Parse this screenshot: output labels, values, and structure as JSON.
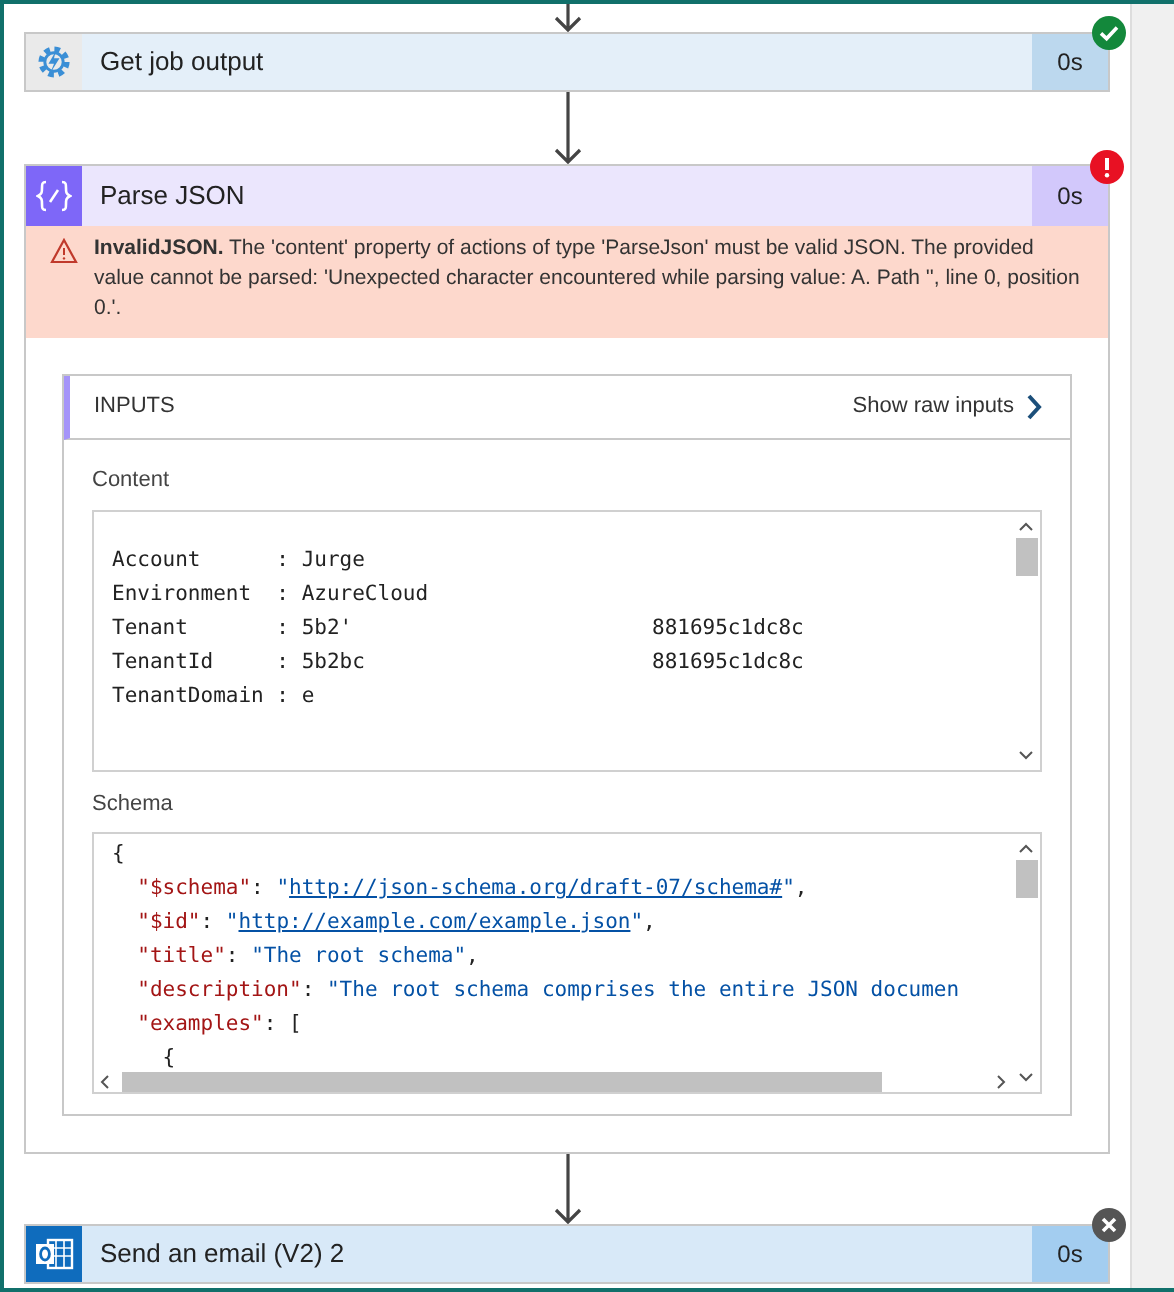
{
  "steps": [
    {
      "kind": "automation",
      "title": "Get job output",
      "duration": "0s",
      "succeeded": true,
      "failed": false,
      "skipped": false,
      "expanded": false
    },
    {
      "kind": "parse",
      "title": "Parse JSON",
      "duration": "0s",
      "succeeded": false,
      "failed": true,
      "skipped": false,
      "expanded": true,
      "error": "**InvalidJSON.** The 'content' property of actions of type 'ParseJson' must be valid JSON. The provided value cannot be parsed: 'Unexpected character encountered while parsing value: A. Path '', line 0, position 0.'.",
      "inputs": {
        "heading": "INPUTS",
        "raw_link": "Show raw inputs",
        "content_label": "Content",
        "content_lines": [
          {
            "text": "Account      : Jurge"
          },
          {
            "text": "Environment  : AzureCloud"
          },
          {
            "text": "Tenant       : 5b2'",
            "tail": "881695c1dc8c"
          },
          {
            "text": "TenantId     : 5b2bc",
            "tail": "881695c1dc8c"
          },
          {
            "text": "TenantDomain : e"
          }
        ],
        "schema_label": "Schema",
        "schema_lines": [
          [
            {
              "kind": "punct",
              "text": "{"
            }
          ],
          [
            {
              "kind": "key",
              "text": "  \"$schema\""
            },
            {
              "kind": "punct",
              "text": ": "
            },
            {
              "kind": "string",
              "text": "\""
            },
            {
              "kind": "link",
              "text": "http://json-schema.org/draft-07/schema#"
            },
            {
              "kind": "string",
              "text": "\""
            },
            {
              "kind": "punct",
              "text": ","
            }
          ],
          [
            {
              "kind": "key",
              "text": "  \"$id\""
            },
            {
              "kind": "punct",
              "text": ": "
            },
            {
              "kind": "string",
              "text": "\""
            },
            {
              "kind": "link",
              "text": "http://example.com/example.json"
            },
            {
              "kind": "string",
              "text": "\""
            },
            {
              "kind": "punct",
              "text": ","
            }
          ],
          [
            {
              "kind": "key",
              "text": "  \"title\""
            },
            {
              "kind": "punct",
              "text": ": "
            },
            {
              "kind": "string",
              "text": "\"The root schema\""
            },
            {
              "kind": "punct",
              "text": ","
            }
          ],
          [
            {
              "kind": "key",
              "text": "  \"description\""
            },
            {
              "kind": "punct",
              "text": ": "
            },
            {
              "kind": "string",
              "text": "\"The root schema comprises the entire JSON documen"
            }
          ],
          [
            {
              "kind": "key",
              "text": "  \"examples\""
            },
            {
              "kind": "punct",
              "text": ": ["
            }
          ],
          [
            {
              "kind": "punct",
              "text": "    {"
            }
          ]
        ]
      }
    },
    {
      "kind": "email",
      "title": "Send an email (V2) 2",
      "duration": "0s",
      "succeeded": false,
      "failed": false,
      "skipped": true,
      "expanded": false
    }
  ]
}
